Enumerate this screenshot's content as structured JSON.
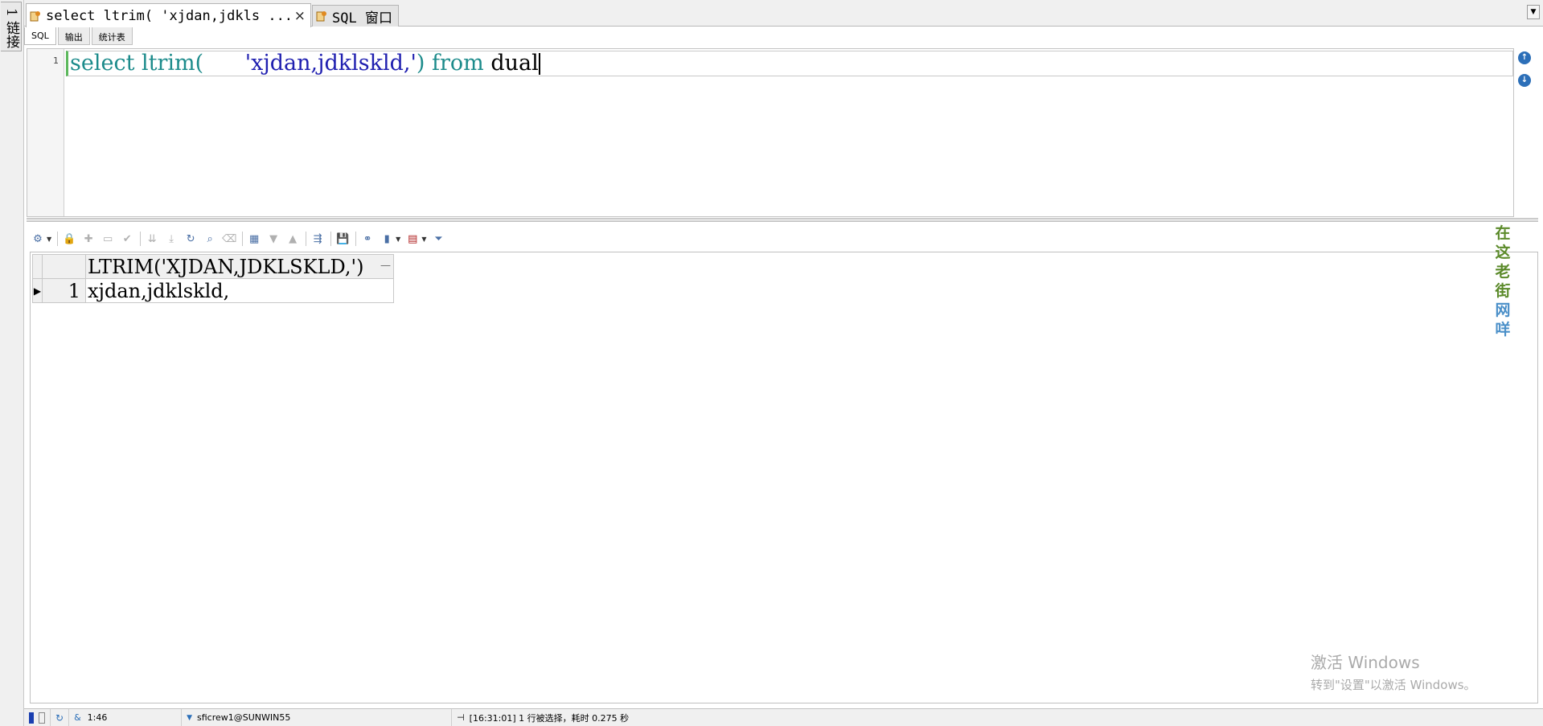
{
  "left_strip": {
    "label": "1 链接"
  },
  "tabs": [
    {
      "label": "select ltrim( 'xjdan,jdkls ...",
      "active": true,
      "close": "×"
    },
    {
      "label": "SQL 窗口",
      "active": false
    }
  ],
  "subtabs": [
    "SQL",
    "输出",
    "统计表"
  ],
  "editor": {
    "line_number": "1",
    "tokens": {
      "select": "select",
      "ltrim": "ltrim(",
      "spaces": "    ",
      "literal": "'xjdan,jdklskld,'",
      "close": ")",
      "from": "from",
      "dual": "dual"
    }
  },
  "grid": {
    "column_header": "LTRIM('XJDAN,JDKLSKLD,')",
    "rows": [
      {
        "num": "1",
        "value": "xjdan,jdklskld,"
      }
    ]
  },
  "watermark": {
    "chars": [
      "在",
      "这",
      "老",
      "街",
      "网",
      "咩"
    ]
  },
  "windows_activation": {
    "line1": "激活 Windows",
    "line2": "转到\"设置\"以激活 Windows。"
  },
  "status": {
    "position": "1:46",
    "connection": "sficrew1@SUNWIN55",
    "message": "[16:31:01]  1 行被选择，耗时 0.275 秒"
  },
  "colors": {
    "keyword": "#1c8b8b",
    "string": "#2020b0",
    "accent_blue": "#2c6fb8"
  }
}
